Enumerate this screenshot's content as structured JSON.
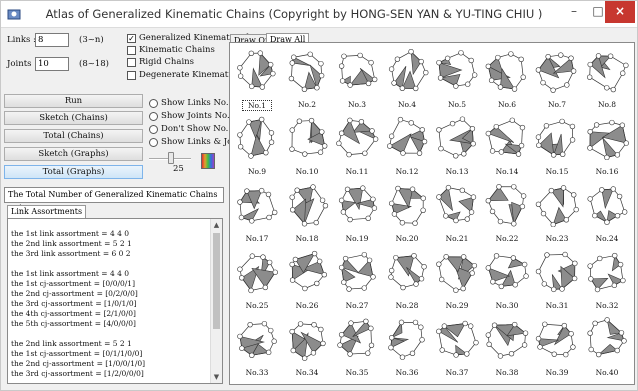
{
  "titlebar": {
    "title": "Atlas of Generalized Kinematic Chains (Copyright by HONG-SEN YAN & YU-TING CHIU )",
    "minimize": "–",
    "maximize": "□",
    "close": "×"
  },
  "inputs": {
    "links_label": "Links :",
    "links_value": "8",
    "links_range": "(3~n)",
    "joints_label": "Joints :",
    "joints_value": "10",
    "joints_range": "(8~18)"
  },
  "chain_types": [
    {
      "label": "Generalized Kinematic Chains",
      "checked": true
    },
    {
      "label": "Kinematic Chains",
      "checked": false
    },
    {
      "label": "Rigid Chains",
      "checked": false
    },
    {
      "label": "Degenerate Kinematic Chains",
      "checked": false
    }
  ],
  "buttons": {
    "run": "Run",
    "sketch_chains": "Sketch (Chains)",
    "total_chains": "Total (Chains)",
    "sketch_graphs": "Sketch (Graphs)",
    "total_graphs": "Total (Graphs)"
  },
  "show_options": [
    {
      "label": "Show Links No."
    },
    {
      "label": "Show Joints No."
    },
    {
      "label": "Don't Show No."
    },
    {
      "label": "Show Links & Joints"
    }
  ],
  "slider": {
    "value": "25"
  },
  "status": "The Total Number of Generalized Kinematic Chains = 40",
  "left_tab": "Link Assortments",
  "list_lines": [
    "the 1st link assortment =  4  4  0",
    "the 2nd link assortment =  5  2  1",
    "the 3rd link assortment =  6  0  2",
    "",
    "the 1st link assortment = 4 4 0",
    "the 1st cj-assortment = [0/0/0/1]",
    "the 2nd cj-assortment = [0/2/0/0]",
    "the 3rd cj-assortment = [1/0/1/0]",
    "the 4th cj-assortment = [2/1/0/0]",
    "the 5th cj-assortment = [4/0/0/0]",
    "",
    "the 2nd link assortment = 5 2 1",
    "the 1st cj-assortment = [0/1/1/0/0]",
    "the 2nd cj-assortment = [1/0/0/1/0]",
    "the 3rd cj-assortment = [1/2/0/0/0]"
  ],
  "right_tabs": [
    "Draw One",
    "Draw All"
  ],
  "chains": [
    "No.1",
    "No.2",
    "No.3",
    "No.4",
    "No.5",
    "No.6",
    "No.7",
    "No.8",
    "No.9",
    "No.10",
    "No.11",
    "No.12",
    "No.13",
    "No.14",
    "No.15",
    "No.16",
    "No.17",
    "No.18",
    "No.19",
    "No.20",
    "No.21",
    "No.22",
    "No.23",
    "No.24",
    "No.25",
    "No.26",
    "No.27",
    "No.28",
    "No.29",
    "No.30",
    "No.31",
    "No.32",
    "No.33",
    "No.34",
    "No.35",
    "No.36",
    "No.37",
    "No.38",
    "No.39",
    "No.40"
  ],
  "colors": {
    "close": "#c7372f",
    "link_fill": "#8c8c8c",
    "canvas": "#ffffff"
  }
}
